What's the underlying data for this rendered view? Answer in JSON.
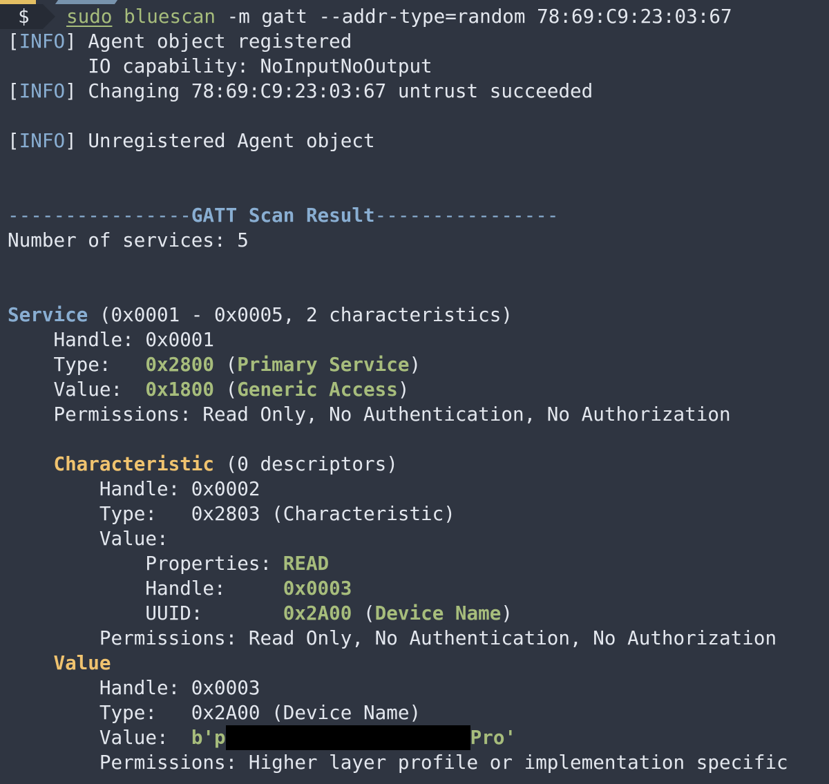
{
  "colors": {
    "background": "#2f3541",
    "text": "#e3e7ee",
    "blue": "#89aed2",
    "green": "#a7bd7c",
    "yellow": "#f0c36f",
    "redaction": "#000000"
  },
  "prompt": {
    "symbol": "$",
    "command_sudo": "sudo",
    "command_prog": "bluescan",
    "command_args": " -m gatt --addr-type=random 78:69:C9:23:03:67"
  },
  "log": {
    "tag_open": "[",
    "tag_name": "INFO",
    "tag_close": "]",
    "line1": " Agent object registered",
    "line2": "       IO capability: NoInputNoOutput",
    "line3": " Changing 78:69:C9:23:03:67 untrust succeeded",
    "line4": " Unregistered Agent object"
  },
  "scan": {
    "header_left": "----------------",
    "header_title": "GATT Scan Result",
    "header_right": "----------------",
    "services_count_label": "Number of services: ",
    "services_count": "5"
  },
  "service": {
    "keyword": "Service",
    "range": " (0x0001 - 0x0005, 2 characteristics)",
    "handle_label": "    Handle: ",
    "handle": "0x0001",
    "type_label": "    Type:   ",
    "type_hex": "0x2800",
    "type_name": "Primary Service",
    "value_label": "    Value:  ",
    "value_hex": "0x1800",
    "value_name": "Generic Access",
    "permissions": "    Permissions: Read Only, No Authentication, No Authorization"
  },
  "characteristic": {
    "keyword": "Characteristic",
    "descriptors": " (0 descriptors)",
    "handle_line": "        Handle: 0x0002",
    "type_line": "        Type:   0x2803 (Characteristic)",
    "value_line": "        Value:",
    "properties_label": "            Properties: ",
    "properties": "READ",
    "handle_label": "            Handle:     ",
    "handle": "0x0003",
    "uuid_label": "            UUID:       ",
    "uuid_hex": "0x2A00",
    "uuid_name": "Device Name",
    "permissions": "        Permissions: Read Only, No Authentication, No Authorization"
  },
  "value_decl": {
    "keyword": "Value",
    "handle_line": "        Handle: 0x0003",
    "type_line": "        Type:   0x2A00 (Device Name)",
    "value_label": "        Value:  ",
    "value_prefix": "b'p",
    "value_suffix": "Pro'",
    "permissions": "        Permissions: Higher layer profile or implementation specific"
  }
}
